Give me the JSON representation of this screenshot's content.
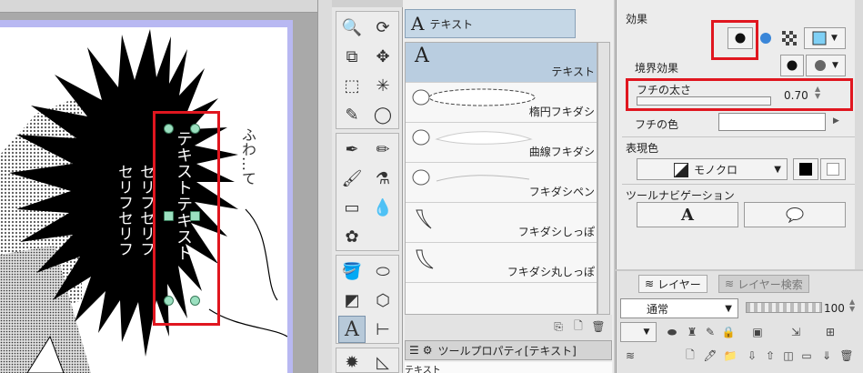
{
  "subtool_panel": {
    "header_label": "テキスト",
    "header_glyph": "A",
    "items": [
      {
        "label": "テキスト",
        "glyph": "A"
      },
      {
        "label": "楕円フキダシ"
      },
      {
        "label": "曲線フキダシ"
      },
      {
        "label": "フキダシペン"
      },
      {
        "label": "フキダシしっぽ"
      },
      {
        "label": "フキダシ丸しっぽ"
      }
    ],
    "property_tab_label": "ツールプロパティ[テキスト]",
    "property_strip_text": "テキスト"
  },
  "canvas": {
    "selected_text": "テキストテキスト",
    "balloon_text_1": "セリフセリフ",
    "balloon_text_2": "セリフセリフ",
    "side_text": "ふわ…て"
  },
  "tool_property": {
    "effect_label": "効果",
    "border_effect_label": "境界効果",
    "border_thickness_label": "フチの太さ",
    "border_thickness_value": "0.70",
    "border_color_label": "フチの色",
    "expression_color_label": "表現色",
    "expression_color_value": "モノクロ",
    "tool_navigation_label": "ツールナビゲーション",
    "nav_text_glyph": "A"
  },
  "layer_panel": {
    "tab_layer": "レイヤー",
    "tab_layer_search": "レイヤー検索",
    "blend_mode": "通常",
    "opacity": "100"
  },
  "colors": {
    "highlight_red": "#e0161f",
    "selection_blue": "#b9cde0",
    "paper_border": "#b8b8f2"
  }
}
